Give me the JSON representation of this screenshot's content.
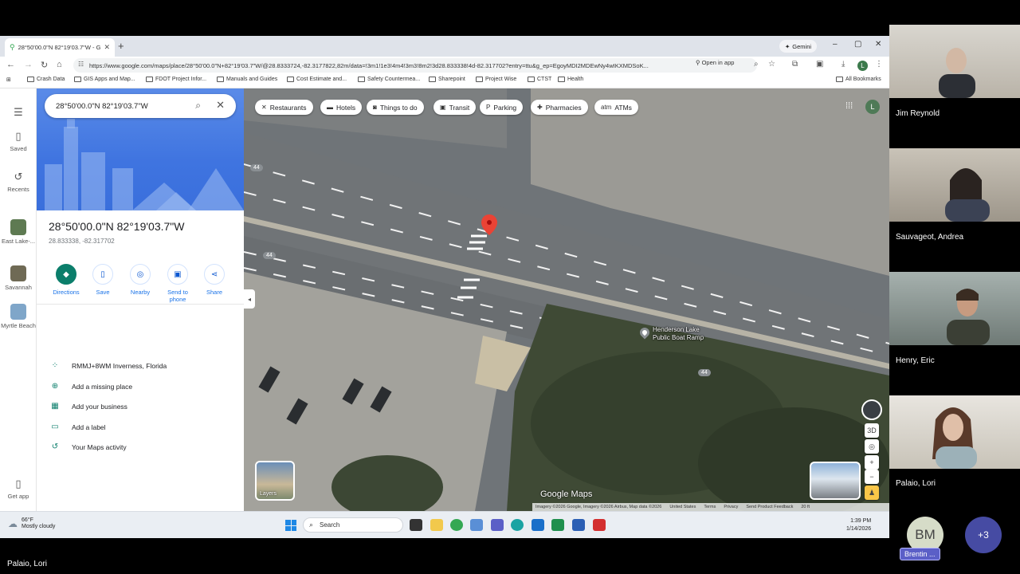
{
  "browser": {
    "tab_title": "28°50'00.0\"N 82°19'03.7\"W - G",
    "gemini": "Gemini",
    "url": "https://www.google.com/maps/place/28°50'00.0\"N+82°19'03.7\"W/@28.8333724,-82.3177822,82m/data=!3m1!1e3!4m4!3m3!8m2!3d28.833338!4d-82.317702?entry=ttu&g_ep=EgoyMDI2MDEwNy4wIKXMDSoK...",
    "open_in_app": "Open in app",
    "profile_initial": "L",
    "bookmarks": [
      "Crash Data",
      "GIS Apps and Map...",
      "FDOT Project Infor...",
      "Manuals and Guides",
      "Cost Estimate and...",
      "Safety Countermea...",
      "Sharepoint",
      "Project Wise",
      "CTST",
      "Health"
    ],
    "all_bookmarks": "All Bookmarks"
  },
  "rail": {
    "saved": "Saved",
    "recents": "Recents",
    "recent_items": [
      "East Lake-...",
      "Savannah",
      "Myrtle Beach"
    ],
    "get_app": "Get app"
  },
  "panel": {
    "search_value": "28°50'00.0\"N 82°19'03.7\"W",
    "title": "28°50'00.0\"N 82°19'03.7\"W",
    "coords": "28.833338, -82.317702",
    "actions": [
      {
        "label": "Directions",
        "icon": "directions-icon"
      },
      {
        "label": "Save",
        "icon": "bookmark-icon"
      },
      {
        "label": "Nearby",
        "icon": "nearby-icon"
      },
      {
        "label": "Send to phone",
        "icon": "phone-icon"
      },
      {
        "label": "Share",
        "icon": "share-icon"
      }
    ],
    "info": [
      {
        "text": "RMMJ+8WM Inverness, Florida",
        "icon": "plus-code-icon"
      },
      {
        "text": "Add a missing place",
        "icon": "add-place-icon"
      },
      {
        "text": "Add your business",
        "icon": "business-icon"
      },
      {
        "text": "Add a label",
        "icon": "label-icon"
      },
      {
        "text": "Your Maps activity",
        "icon": "history-icon"
      }
    ]
  },
  "map": {
    "chips": [
      "Restaurants",
      "Hotels",
      "Things to do",
      "Transit",
      "Parking",
      "Pharmacies",
      "ATMs"
    ],
    "poi": [
      "Henderson Lake",
      "Public Boat Ramp"
    ],
    "route_shield": "44",
    "logo": "Google Maps",
    "layers": "Layers",
    "footer": [
      "Imagery ©2026 Google, Imagery ©2026 Airbus, Map data ©2026",
      "United States",
      "Terms",
      "Privacy",
      "Send Product Feedback",
      "20 ft"
    ],
    "three_d": "3D"
  },
  "taskbar": {
    "temp": "66°F",
    "weather": "Mostly cloudy",
    "search": "Search",
    "time": "1:39 PM",
    "date": "1/14/2026"
  },
  "meeting": {
    "participants": [
      "Jim Reynold",
      "Sauvageot, Andrea",
      "Henry, Eric",
      "Palaio, Lori"
    ],
    "bm_initials": "BM",
    "bm_name": "Brentin ...",
    "more": "+3",
    "presenter": "Palaio, Lori"
  },
  "colors": {
    "accent": "#1a73e8",
    "directions": "#0b7e6b",
    "pin": "#ea4335",
    "teams": "#5b5fc7"
  }
}
